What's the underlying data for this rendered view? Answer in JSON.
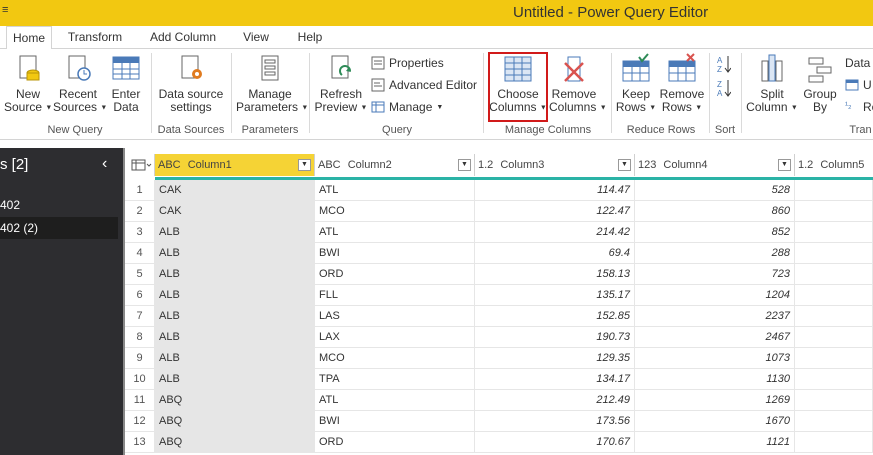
{
  "window": {
    "title": "Untitled - Power Query Editor",
    "qa_glyph": "≡"
  },
  "tabs": [
    {
      "label": "Home",
      "active": true
    },
    {
      "label": "Transform"
    },
    {
      "label": "Add Column"
    },
    {
      "label": "View"
    },
    {
      "label": "Help"
    }
  ],
  "ribbon": {
    "new_source": [
      "New",
      "Source"
    ],
    "recent_sources": [
      "Recent",
      "Sources"
    ],
    "enter_data": [
      "Enter",
      "Data"
    ],
    "data_source_settings": [
      "Data source",
      "settings"
    ],
    "manage_parameters": [
      "Manage",
      "Parameters"
    ],
    "refresh_preview": [
      "Refresh",
      "Preview"
    ],
    "properties": "Properties",
    "advanced_editor": "Advanced Editor",
    "manage": "Manage",
    "choose_columns": [
      "Choose",
      "Columns"
    ],
    "remove_columns": [
      "Remove",
      "Columns"
    ],
    "keep_rows": [
      "Keep",
      "Rows"
    ],
    "remove_rows": [
      "Remove",
      "Rows"
    ],
    "split_column": [
      "Split",
      "Column"
    ],
    "group_by": [
      "Group",
      "By"
    ],
    "data_type_partial": "Data T",
    "use_first_row_partial": "U",
    "replace_partial": "Re",
    "groups": {
      "new_query": "New Query",
      "data_sources": "Data Sources",
      "parameters": "Parameters",
      "query": "Query",
      "manage_columns": "Manage Columns",
      "reduce_rows": "Reduce Rows",
      "sort": "Sort",
      "transform_partial": "Tran"
    }
  },
  "queries_pane": {
    "header": "s [2]",
    "collapse_glyph": "‹",
    "items": [
      {
        "label": "402",
        "selected": false
      },
      {
        "label": "402 (2)",
        "selected": true
      }
    ]
  },
  "grid": {
    "columns": [
      {
        "type": "ABC",
        "name": "Column1",
        "selected": true
      },
      {
        "type": "ABC",
        "name": "Column2"
      },
      {
        "type": "1.2",
        "name": "Column3"
      },
      {
        "type": "123",
        "name": "Column4"
      },
      {
        "type": "1.2",
        "name": "Column5"
      }
    ],
    "rows": [
      [
        "1",
        "CAK",
        "ATL",
        "114.47",
        "528"
      ],
      [
        "2",
        "CAK",
        "MCO",
        "122.47",
        "860"
      ],
      [
        "3",
        "ALB",
        "ATL",
        "214.42",
        "852"
      ],
      [
        "4",
        "ALB",
        "BWI",
        "69.4",
        "288"
      ],
      [
        "5",
        "ALB",
        "ORD",
        "158.13",
        "723"
      ],
      [
        "6",
        "ALB",
        "FLL",
        "135.17",
        "1204"
      ],
      [
        "7",
        "ALB",
        "LAS",
        "152.85",
        "2237"
      ],
      [
        "8",
        "ALB",
        "LAX",
        "190.73",
        "2467"
      ],
      [
        "9",
        "ALB",
        "MCO",
        "129.35",
        "1073"
      ],
      [
        "10",
        "ALB",
        "TPA",
        "134.17",
        "1130"
      ],
      [
        "11",
        "ABQ",
        "ATL",
        "212.49",
        "1269"
      ],
      [
        "12",
        "ABQ",
        "BWI",
        "173.56",
        "1670"
      ],
      [
        "13",
        "ABQ",
        "ORD",
        "170.67",
        "1121"
      ]
    ]
  },
  "colors": {
    "accent": "#f2c811",
    "teal": "#2ab3a6",
    "highlight": "#d11a1a"
  }
}
